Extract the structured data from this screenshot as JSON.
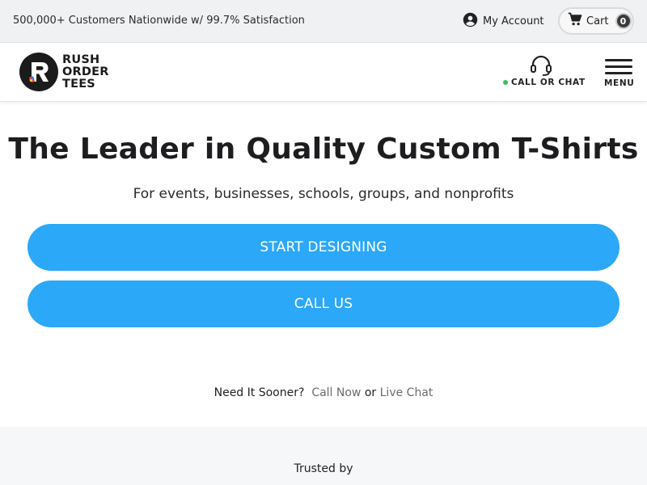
{
  "topbar": {
    "promo": "500,000+ Customers Nationwide w/ 99.7% Satisfaction",
    "account_label": "My Account",
    "account_icon": "user-circle-icon",
    "cart_label": "Cart",
    "cart_icon": "cart-icon",
    "cart_count": "0"
  },
  "header": {
    "logo_line1": "RUSH",
    "logo_line2": "ORDER",
    "logo_line3": "TEES",
    "call_chat_label": "CALL OR CHAT",
    "call_chat_icon": "headset-icon",
    "menu_label": "MENU",
    "menu_icon": "hamburger-icon"
  },
  "hero": {
    "title": "The Leader in Quality Custom T-Shirts",
    "subtitle": "For events, businesses, schools, groups, and nonprofits",
    "start_button": "START DESIGNING",
    "call_button": "CALL US"
  },
  "sooner": {
    "prefix": "Need It Sooner?",
    "call_now": "Call Now",
    "or": "or",
    "live_chat": "Live Chat"
  },
  "trusted": {
    "label": "Trusted by"
  },
  "colors": {
    "accent": "#2ba8f8",
    "online_dot": "#3cc05b",
    "topbar_bg": "#f0f1f3"
  }
}
